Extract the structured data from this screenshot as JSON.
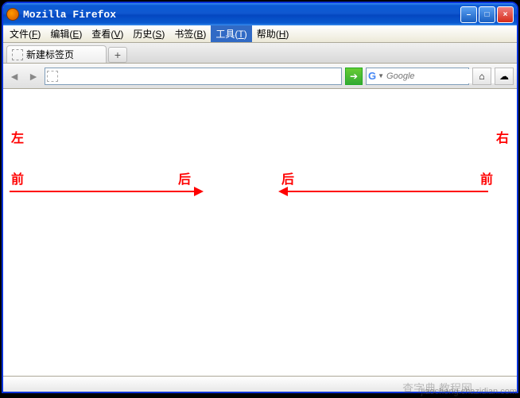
{
  "window": {
    "title": "Mozilla Firefox",
    "min_label": "–",
    "max_label": "□",
    "close_label": "×"
  },
  "menu": {
    "items": [
      {
        "label": "文件",
        "accel": "F"
      },
      {
        "label": "编辑",
        "accel": "E"
      },
      {
        "label": "查看",
        "accel": "V"
      },
      {
        "label": "历史",
        "accel": "S"
      },
      {
        "label": "书签",
        "accel": "B"
      },
      {
        "label": "工具",
        "accel": "T"
      },
      {
        "label": "帮助",
        "accel": "H"
      }
    ],
    "active_index": 5
  },
  "tab": {
    "title": "新建标签页",
    "newtab_symbol": "+"
  },
  "toolbar": {
    "back_symbol": "◄",
    "forward_symbol": "►",
    "go_symbol": "➔",
    "url_value": "",
    "search_placeholder": "Google",
    "search_value": "",
    "home_symbol": "⌂",
    "addon_symbol": "☁"
  },
  "content": {
    "left_label": "左",
    "right_label": "右",
    "before_label": "前",
    "after_label": "后"
  },
  "watermark": {
    "small": "jiaocheng.chazidian.com",
    "big": "查字典 教程网"
  }
}
